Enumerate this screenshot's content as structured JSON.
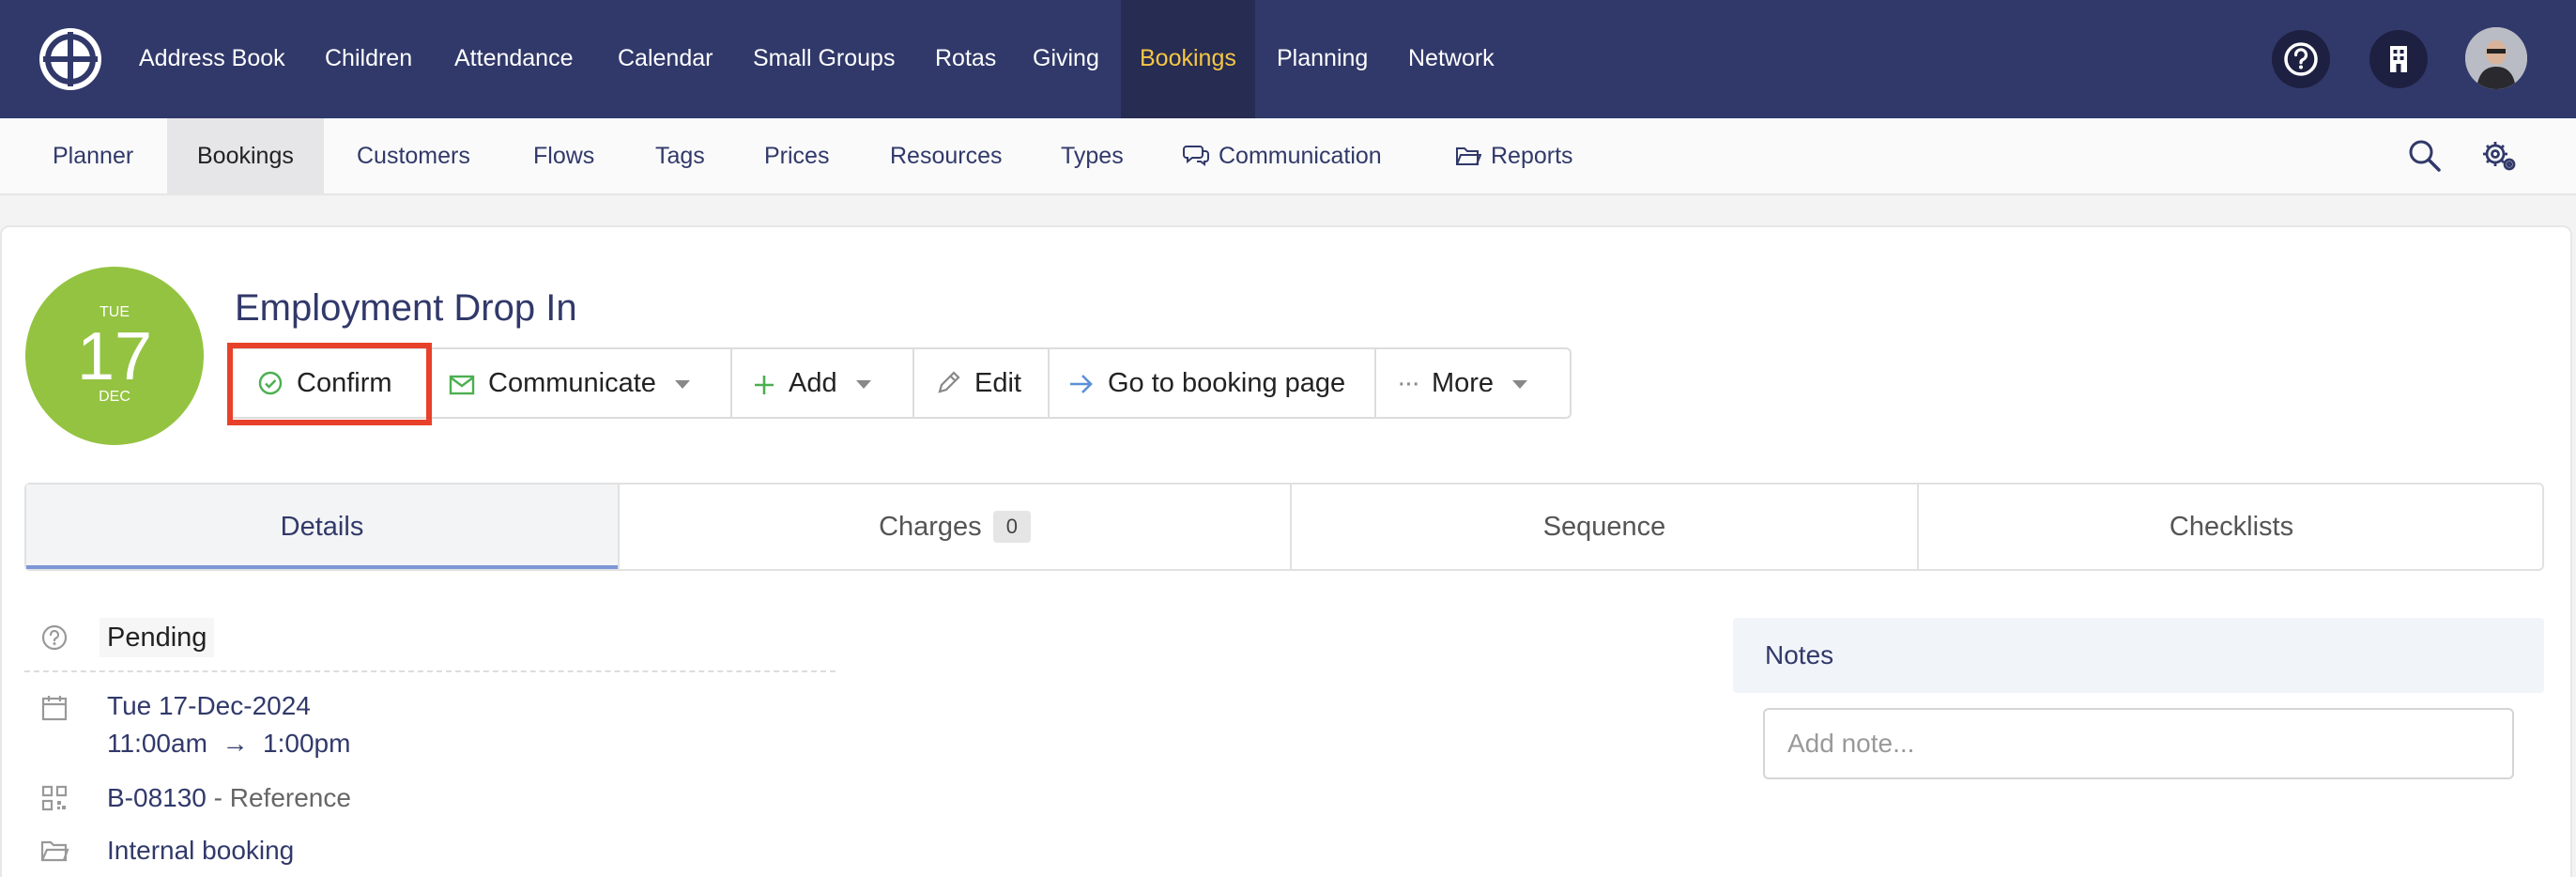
{
  "topnav": {
    "items": [
      "Address Book",
      "Children",
      "Attendance",
      "Calendar",
      "Small Groups",
      "Rotas",
      "Giving",
      "Bookings",
      "Planning",
      "Network"
    ],
    "active": "Bookings"
  },
  "subnav": {
    "items": [
      "Planner",
      "Bookings",
      "Customers",
      "Flows",
      "Tags",
      "Prices",
      "Resources",
      "Types",
      "Communication",
      "Reports"
    ],
    "active": "Bookings"
  },
  "booking": {
    "date": {
      "dow": "TUE",
      "day": "17",
      "month": "DEC"
    },
    "title": "Employment Drop In",
    "status": "Pending",
    "date_long": "Tue 17-Dec-2024",
    "time_start": "11:00am",
    "time_arrow": "→",
    "time_end": "1:00pm",
    "reference_code": "B-08130",
    "reference_suffix": " - Reference",
    "type": "Internal booking"
  },
  "actions": {
    "confirm": "Confirm",
    "communicate": "Communicate",
    "add": "Add",
    "edit": "Edit",
    "goto": "Go to booking page",
    "more_dots": "···",
    "more": "More"
  },
  "tabs": {
    "details": "Details",
    "charges": "Charges",
    "charges_count": "0",
    "sequence": "Sequence",
    "checklists": "Checklists"
  },
  "notes": {
    "title": "Notes",
    "placeholder": "Add note..."
  },
  "colors": {
    "navbar": "#31396a",
    "accent": "#f7c744",
    "date_circle": "#94c341",
    "highlight": "#e8412b"
  },
  "icons": {
    "help": "help-icon",
    "organisation": "building-icon",
    "search": "search-icon",
    "settings": "gear-icon"
  }
}
